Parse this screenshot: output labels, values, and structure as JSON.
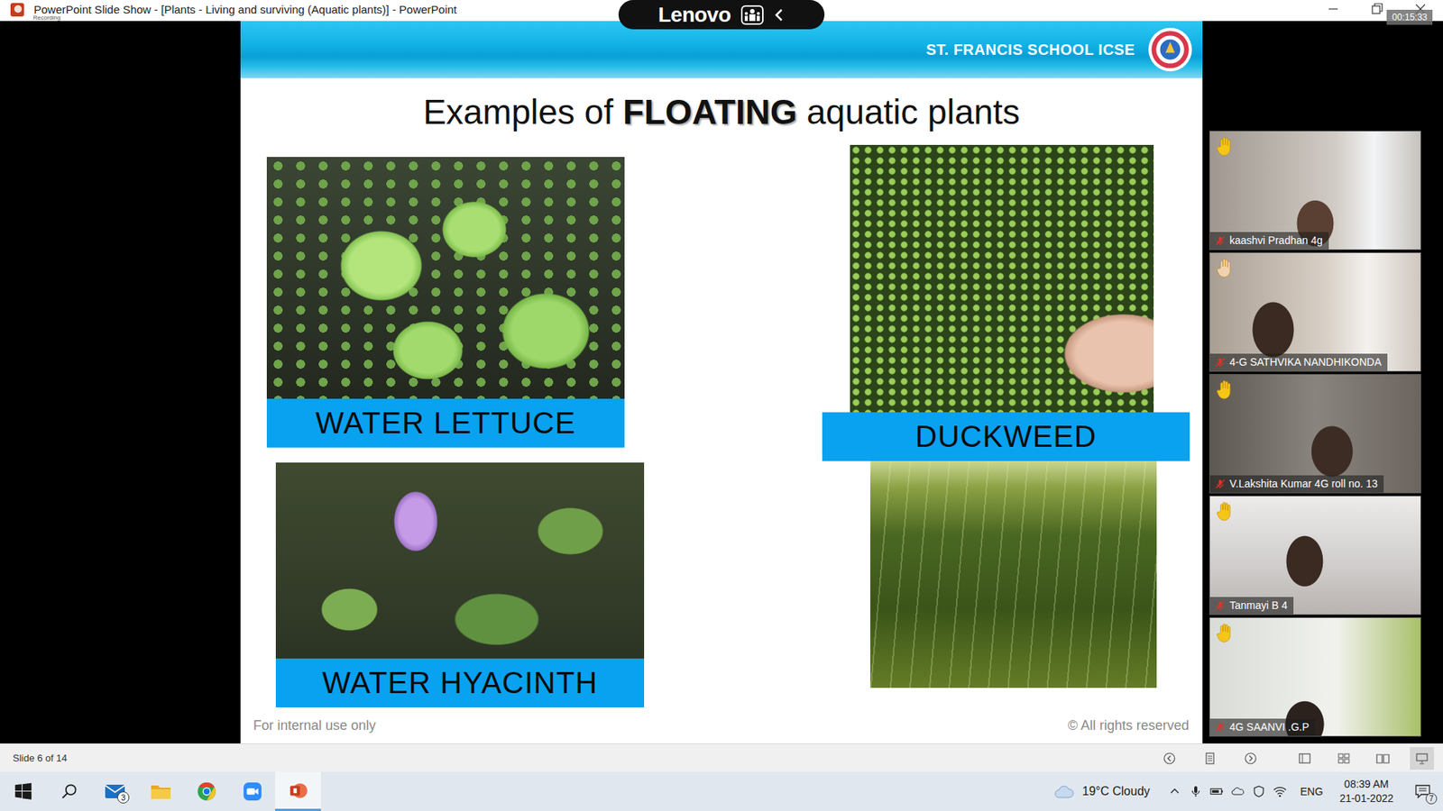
{
  "window": {
    "title": "PowerPoint Slide Show - [Plants - Living and surviving (Aquatic plants)] - PowerPoint",
    "recording_label": "Recording",
    "timer": "00:15:33"
  },
  "brand": {
    "label": "Lenovo"
  },
  "slide": {
    "school": "ST. FRANCIS SCHOOL ICSE",
    "title": [
      {
        "text": "Examples of ",
        "emphasis": false
      },
      {
        "text": "FLOATING",
        "emphasis": true
      },
      {
        "text": " aquatic plants",
        "emphasis": false
      }
    ],
    "left_column": [
      {
        "kind": "labeled-photo",
        "label": "WATER LETTUCE"
      },
      {
        "kind": "labeled-photo",
        "label": "WATER HYACINTH"
      }
    ],
    "right_column": [
      {
        "kind": "labeled-photo",
        "label": "DUCKWEED"
      },
      {
        "kind": "photo"
      }
    ],
    "footer_left": "For internal use only",
    "footer_right": "© All rights reserved"
  },
  "participants": [
    {
      "name": "kaashvi Pradhan 4g",
      "hand_raised": true,
      "muted": true,
      "color": "#f5c518"
    },
    {
      "name": "4-G SATHVIKA NANDHIKONDA",
      "hand_raised": true,
      "muted": true,
      "color": "#f1d2b0"
    },
    {
      "name": "V.Lakshita Kumar 4G roll no. 13",
      "hand_raised": true,
      "muted": true,
      "color": "#f5c518"
    },
    {
      "name": "Tanmayi B 4",
      "hand_raised": true,
      "muted": true,
      "color": "#f5c518"
    },
    {
      "name": "4G SAANVI .G.P",
      "hand_raised": true,
      "muted": true,
      "color": "#f5c518"
    }
  ],
  "status_bar": {
    "slide_counter": "Slide 6 of 14",
    "views": [
      {
        "name": "normal",
        "selected": false
      },
      {
        "name": "sorter",
        "selected": false
      },
      {
        "name": "reading",
        "selected": false
      },
      {
        "name": "slideshow",
        "selected": true
      }
    ]
  },
  "taskbar": {
    "apps": [
      {
        "name": "mail",
        "badge": "3",
        "active": false
      },
      {
        "name": "explorer",
        "badge": "",
        "active": false
      },
      {
        "name": "chrome",
        "badge": "",
        "active": false
      },
      {
        "name": "zoom",
        "badge": "",
        "active": false
      },
      {
        "name": "powerpoint",
        "badge": "",
        "active": true
      }
    ],
    "weather": "19°C Cloudy",
    "language": "ENG",
    "time": "08:39 AM",
    "date": "21-01-2022",
    "notifications": "7"
  }
}
